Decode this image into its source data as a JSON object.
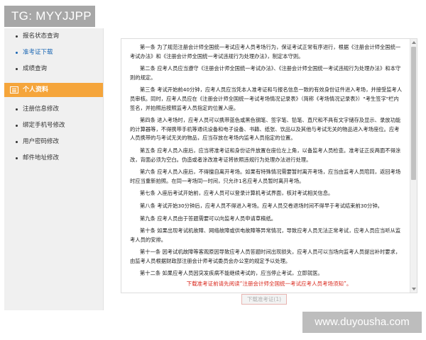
{
  "watermark_top": "TG: MYYJJPP",
  "watermark_bottom": "www.duyousha.com",
  "sidebar": {
    "items_top": [
      {
        "label": "报名状态查询"
      },
      {
        "label": "准考证下载"
      },
      {
        "label": "成绩查询"
      }
    ],
    "active_index": 1,
    "group_label": "个人资料",
    "items_bottom": [
      {
        "label": "注册信息修改"
      },
      {
        "label": "绑定手机号修改"
      },
      {
        "label": "用户密码修改"
      },
      {
        "label": "邮件地址修改"
      }
    ]
  },
  "notice": {
    "paragraphs": [
      "第一条 为了规范注册会计师全国统一考试应考人员考场行为，保证考试正常有序进行，根据《注册会计师全国统一考试办法》和《注册会计师全国统一考试违规行为处理办法》，制定本守则。",
      "第二条 应考人员应当遵守《注册会计师全国统一考试办法》、《注册会计师全国统一考试违规行为处理办法》和本守则的规定。",
      "第三条 考试开始前40分钟，应考人员应当凭本人准考证和与报名信息一致的有效身份证件进入考场，并接受监考人员审核。同时，应考人员应在《注册会计师全国统一考试考场情况记录表》（简称《考场情况记录表》）\"考生签字\"栏内签名，并拍照后按照监考人员指定的位置入座。",
      "第四条 进入考场时，应考人员可以携带蓝色或黑色钢笔、签字笔、铅笔、直尺和不具有文字储存及显示、录放功能的计算器等，不得携带手机等通讯设备和电子设备、书籍、纸张、饮品以及其他与考试无关的物品进入考场座位。应考人员携带的与考试无关的物品，应当存放在考场内监考人员指定的位置。",
      "第五条 应考人员入座后，应当将准考证和身份证件放置在座位左上角，以备监考人员检查。准考证正反两面不得涂改，背面必须为空白。伪造或者涂改准考证将依照违规行为处理办法进行处理。",
      "第六条 应考人员入座后，不得擅自离开考场。如果有特殊情况需要暂时离开考场，应当由监考人员陪同，返回考场时应当重新拍照。在同一考场同一时间，只允许1名应考人员暂时离开考场。",
      "第七条 入座后考试开始前，应考人员可以登录计算机考试界面，核对考试相关信息。",
      "第八条 考试开始30分钟后，应考人员不得进入考场。应考人员交卷退场时间不得早于考试结束前30分钟。",
      "第九条 应考人员由于答题需要可以向监考人员申请草稿纸。",
      "第十条 如果出现考试机故障、网络故障或供电故障等异常情况，导致应考人员无法正常考试，应考人员应当听从监考人员的安排。",
      "第十一条 因考试机故障等客观原因导致应考人员答题时间出现损失，应考人员可以当场向监考人员提出补时要求，由监考人员根据财政部注册会计师考试委员会办公室的规定予以处理。",
      "第十二条 如果应考人员因突发疾病不能继续考试的，应当停止考试，立即就医。"
    ]
  },
  "warning": "下载准考证前请先阅读“注册会计师全国统一考试应考人员考场须知”。",
  "download_button": "下载准考证(1)"
}
